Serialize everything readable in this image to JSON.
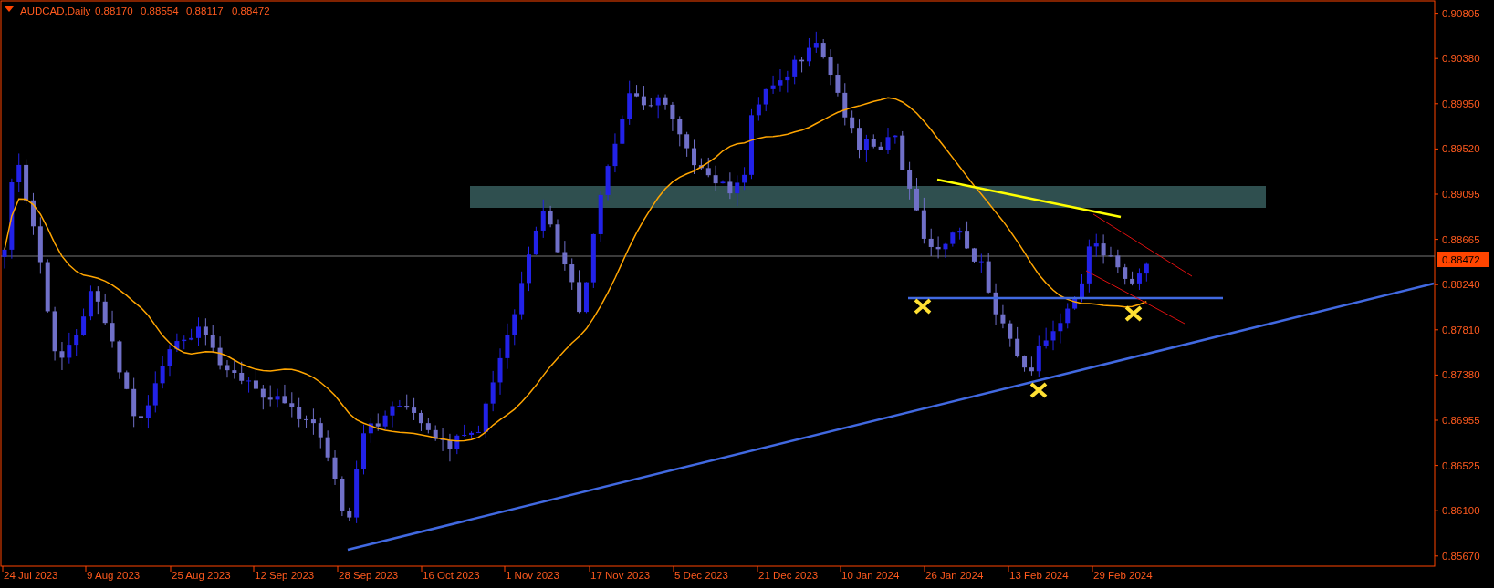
{
  "header": {
    "symbol": "AUDCAD,Daily",
    "ohlc": [
      "0.88170",
      "0.88554",
      "0.88117",
      "0.88472"
    ]
  },
  "price_axis": {
    "labels": [
      "0.90805",
      "0.90380",
      "0.89950",
      "0.89520",
      "0.89095",
      "0.88665",
      "0.88240",
      "0.87810",
      "0.87380",
      "0.86955",
      "0.86525",
      "0.86100",
      "0.85670"
    ],
    "current_price": "0.88472"
  },
  "time_axis": {
    "labels": [
      "24 Jul 2023",
      "9 Aug 2023",
      "25 Aug 2023",
      "12 Sep 2023",
      "28 Sep 2023",
      "16 Oct 2023",
      "1 Nov 2023",
      "17 Nov 2023",
      "5 Dec 2023",
      "21 Dec 2023",
      "10 Jan 2024",
      "26 Jan 2024",
      "13 Feb 2024",
      "29 Feb 2024"
    ]
  }
}
